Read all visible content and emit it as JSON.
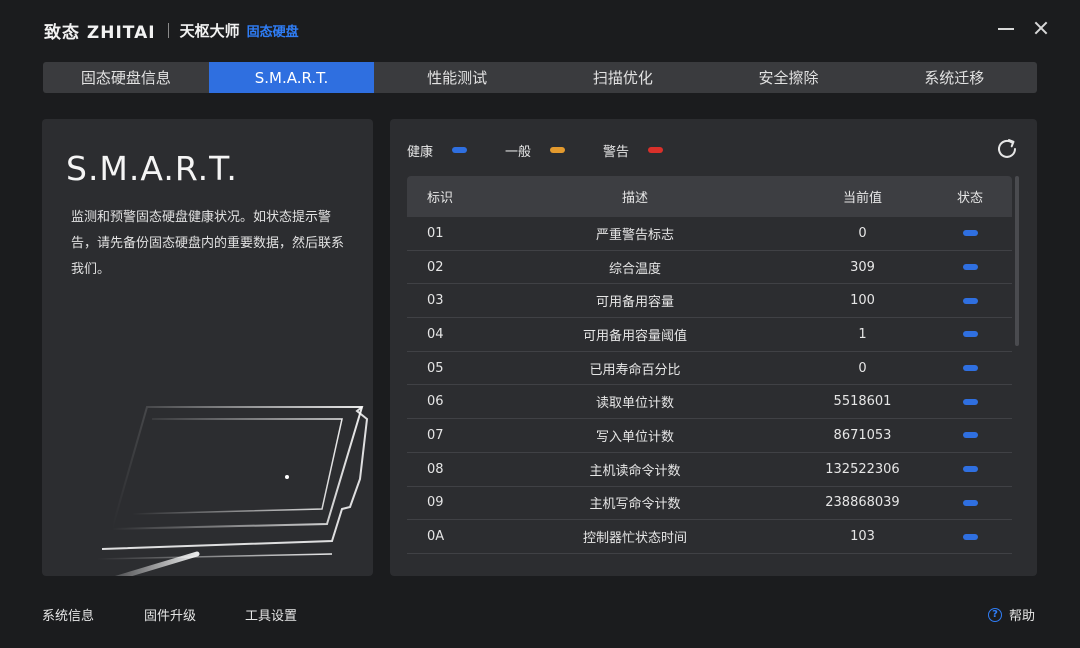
{
  "app": {
    "logo": "致态 ZHITAI",
    "name": "天枢大师",
    "product": "固态硬盘"
  },
  "tabs": [
    {
      "label": "固态硬盘信息",
      "active": false
    },
    {
      "label": "S.M.A.R.T.",
      "active": true
    },
    {
      "label": "性能测试",
      "active": false
    },
    {
      "label": "扫描优化",
      "active": false
    },
    {
      "label": "安全擦除",
      "active": false
    },
    {
      "label": "系统迁移",
      "active": false
    }
  ],
  "info": {
    "title": "S.M.A.R.T.",
    "description": "监测和预警固态硬盘健康状况。如状态提示警告，请先备份固态硬盘内的重要数据，然后联系我们。"
  },
  "legend": [
    {
      "label": "健康",
      "color": "#2f6fe0"
    },
    {
      "label": "一般",
      "color": "#e39a2e"
    },
    {
      "label": "警告",
      "color": "#d9302a"
    }
  ],
  "table": {
    "columns": [
      "标识",
      "描述",
      "当前值",
      "状态"
    ],
    "rows": [
      {
        "id": "01",
        "desc": "严重警告标志",
        "value": "0",
        "status": "healthy"
      },
      {
        "id": "02",
        "desc": "综合温度",
        "value": "309",
        "status": "healthy"
      },
      {
        "id": "03",
        "desc": "可用备用容量",
        "value": "100",
        "status": "healthy"
      },
      {
        "id": "04",
        "desc": "可用备用容量阈值",
        "value": "1",
        "status": "healthy"
      },
      {
        "id": "05",
        "desc": "已用寿命百分比",
        "value": "0",
        "status": "healthy"
      },
      {
        "id": "06",
        "desc": "读取单位计数",
        "value": "5518601",
        "status": "healthy"
      },
      {
        "id": "07",
        "desc": "写入单位计数",
        "value": "8671053",
        "status": "healthy"
      },
      {
        "id": "08",
        "desc": "主机读命令计数",
        "value": "132522306",
        "status": "healthy"
      },
      {
        "id": "09",
        "desc": "主机写命令计数",
        "value": "238868039",
        "status": "healthy"
      },
      {
        "id": "0A",
        "desc": "控制器忙状态时间",
        "value": "103",
        "status": "healthy"
      }
    ]
  },
  "status_colors": {
    "healthy": "#2f6fe0",
    "normal": "#e39a2e",
    "warning": "#d9302a"
  },
  "footer": {
    "links": [
      "系统信息",
      "固件升级",
      "工具设置"
    ],
    "help": "帮助"
  }
}
